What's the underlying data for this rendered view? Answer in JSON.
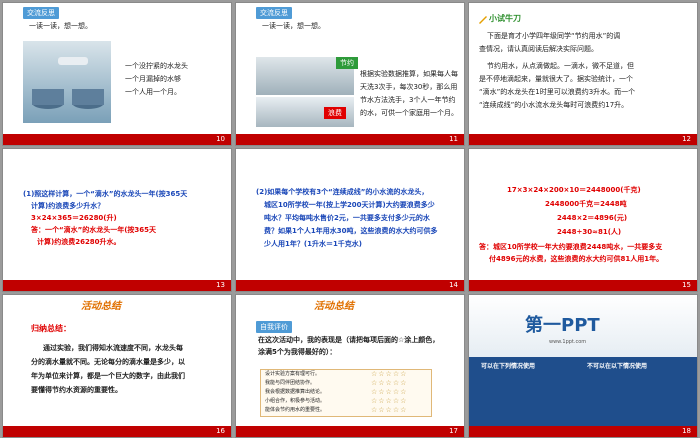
{
  "slides": [
    {
      "num": "10",
      "tag": "交流反思",
      "subtitle": "一读一读，想一想。",
      "lines": [
        "一个没拧紧的水龙头",
        "一个月漏掉的水够",
        "一个人用一个月。"
      ]
    },
    {
      "num": "11",
      "tag": "交流反思",
      "subtitle": "一读一读，想一想。",
      "badge1": "节约",
      "badge2": "浪费",
      "lines": [
        "根据实验数据推算，如果每人每",
        "天洗3次手，每次30秒，那么用",
        "节水方法洗手，3个人一年节约",
        "的水，可供一个家庭用一个月。"
      ]
    },
    {
      "num": "12",
      "title": "小试牛刀",
      "lines": [
        "下面是育才小学四年级同学“节约用水”的调",
        "查情况，请认真阅读后解决实际问题。",
        "节约用水，从点滴做起。一滴水，微不足道，但",
        "是不停地滴起来，量就很大了。据实验统计，一个",
        "“滴水”的水龙头在1时里可以浪费约3升水。而一个",
        "“连续成线”的小水流水龙头每时可浪费约17升。"
      ]
    },
    {
      "num": "13",
      "lines": [
        "(1)照这样计算，一个“滴水”的水龙头一年(按365天",
        "计算)约浪费多少升水？",
        "3×24×365＝26280(升)",
        "答：一个“滴水”的水龙头一年(按365天",
        "计算)约浪费26280升水。"
      ]
    },
    {
      "num": "14",
      "lines": [
        "(2)如果每个学校有3个“连续成线”的小水流的水龙头，",
        "城区10所学校一年(按上学200天计算)大约要浪费多少",
        "吨水？平均每吨水售价2元，一共要多支付多少元的水",
        "费？如果1个人1年用水30吨，这些浪费的水大约可供多",
        "少人用1年？(1升水＝1千克水)"
      ]
    },
    {
      "num": "15",
      "lines": [
        "17×3×24×200×10＝2448000(千克)",
        "2448000千克＝2448吨",
        "2448×2＝4896(元)",
        "2448÷30≈81(人)",
        "答：城区10所学校一年大约要浪费2448吨水，一共要多支",
        "付4896元的水费，这些浪费的水大约可供81人用1年。"
      ]
    },
    {
      "num": "16",
      "title": "活动总结",
      "heading": "归纳总结：",
      "lines": [
        "通过实验，我们得知水流速度不同，水龙头每",
        "分的滴水量就不同。无论每分的滴水量是多少，以",
        "年为单位来计算，都是一个巨大的数字，由此我们",
        "要懂得节约水资源的重要性。"
      ]
    },
    {
      "num": "17",
      "title": "活动总结",
      "tag": "自我评价",
      "lines": [
        "在这次活动中，我的表现是（请把每项后面的☆涂上颜色，",
        "涂满5个为我得最好的）："
      ],
      "rows": [
        "设计实验方案有理可行。",
        "我能与同伴团结协作。",
        "我会根据数据推算出结论。",
        "小组合作，积极参与活动。",
        "能体会节约用水的重要性。"
      ],
      "stars": "☆☆☆☆☆"
    },
    {
      "num": "18",
      "logo": "第一PPT",
      "url": "www.1ppt.com",
      "left_head": "可以在下列情况使用",
      "right_head": "不可以在以下情况使用"
    }
  ],
  "colors": {
    "bar": "#c00000",
    "tag": "#4f9bd6",
    "red": "#e00000",
    "blue": "#1a47b8"
  }
}
